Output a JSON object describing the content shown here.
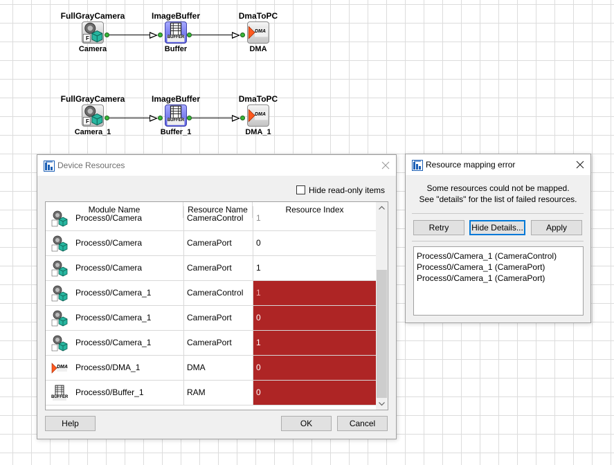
{
  "diagram": {
    "rows": [
      {
        "camera": {
          "type": "FullGrayCamera",
          "label": "Camera"
        },
        "buffer": {
          "type": "ImageBuffer",
          "label": "Buffer"
        },
        "dma": {
          "type": "DmaToPC",
          "label": "DMA"
        }
      },
      {
        "camera": {
          "type": "FullGrayCamera",
          "label": "Camera_1"
        },
        "buffer": {
          "type": "ImageBuffer",
          "label": "Buffer_1"
        },
        "dma": {
          "type": "DmaToPC",
          "label": "DMA_1"
        }
      }
    ],
    "icon_text": {
      "camera": "F",
      "buffer": "BUFFER",
      "dma": "DMA"
    }
  },
  "device_resources": {
    "title": "Device Resources",
    "hide_readonly_label": "Hide read-only items",
    "hide_readonly_checked": false,
    "columns": {
      "module": "Module Name",
      "resource": "Resource Name",
      "index": "Resource Index"
    },
    "rows": [
      {
        "icon": "camera-icon",
        "module": "Process0/Camera",
        "resource": "CameraControl",
        "index": "1",
        "error": false,
        "readonly": true
      },
      {
        "icon": "camera-icon",
        "module": "Process0/Camera",
        "resource": "CameraPort",
        "index": "0",
        "error": false,
        "readonly": false
      },
      {
        "icon": "camera-icon",
        "module": "Process0/Camera",
        "resource": "CameraPort",
        "index": "1",
        "error": false,
        "readonly": false
      },
      {
        "icon": "camera-icon",
        "module": "Process0/Camera_1",
        "resource": "CameraControl",
        "index": "1",
        "error": true,
        "readonly": true
      },
      {
        "icon": "camera-icon",
        "module": "Process0/Camera_1",
        "resource": "CameraPort",
        "index": "0",
        "error": true,
        "readonly": false
      },
      {
        "icon": "camera-icon",
        "module": "Process0/Camera_1",
        "resource": "CameraPort",
        "index": "1",
        "error": true,
        "readonly": false
      },
      {
        "icon": "dma-icon",
        "module": "Process0/DMA_1",
        "resource": "DMA",
        "index": "0",
        "error": true,
        "readonly": false
      },
      {
        "icon": "buffer-icon",
        "module": "Process0/Buffer_1",
        "resource": "RAM",
        "index": "0",
        "error": true,
        "readonly": false
      }
    ],
    "buttons": {
      "help": "Help",
      "ok": "OK",
      "cancel": "Cancel"
    }
  },
  "mapping_error": {
    "title": "Resource mapping error",
    "message_line1": "Some resources could not be mapped.",
    "message_line2": "See \"details\" for the list of failed resources.",
    "buttons": {
      "retry": "Retry",
      "hide_details": "Hide Details...",
      "apply": "Apply"
    },
    "details": [
      "Process0/Camera_1 (CameraControl)",
      "Process0/Camera_1 (CameraPort)",
      "Process0/Camera_1 (CameraPort)"
    ]
  },
  "colors": {
    "error_cell": "#ae2525",
    "buffer_block": "#6a6ef0",
    "port": "#3ab83a",
    "focus_border": "#0078d7"
  }
}
